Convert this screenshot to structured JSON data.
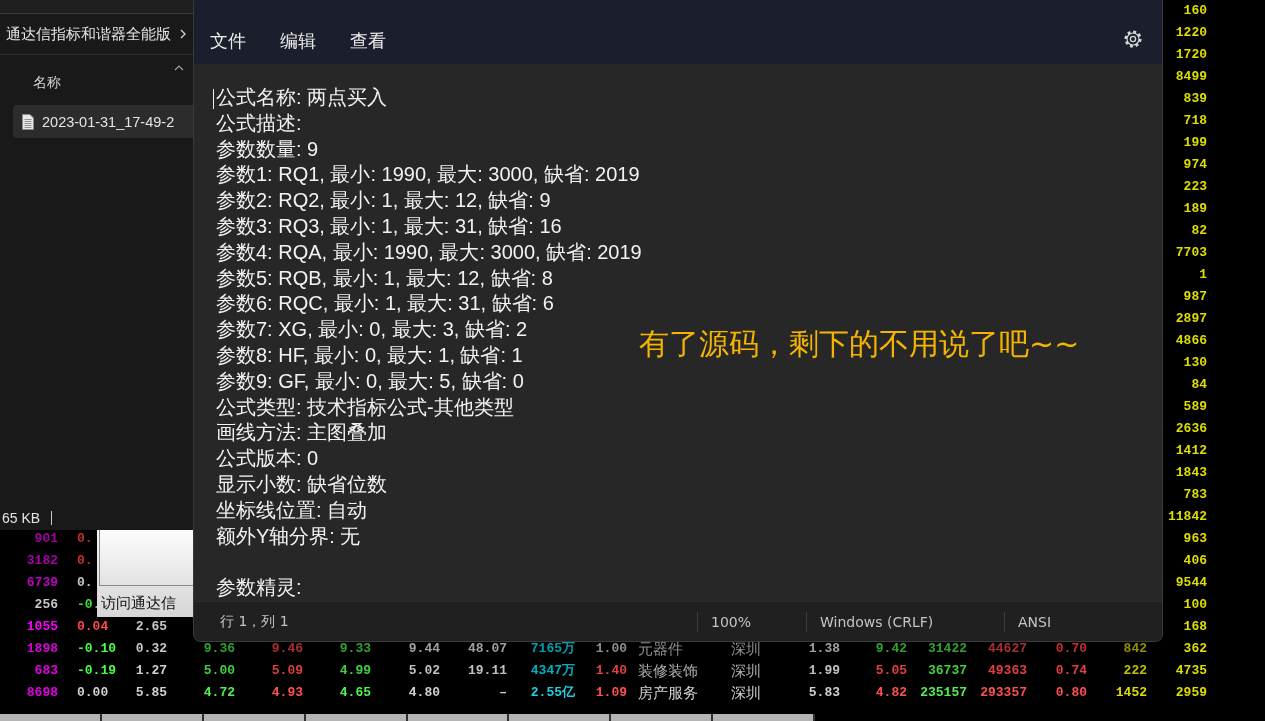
{
  "quote_table": {
    "rows": [
      {
        "last_column": {
          "text": "160",
          "color": "#dede00"
        }
      },
      {
        "last_column": {
          "text": "1220",
          "color": "#dede00"
        }
      },
      {
        "last_column": {
          "text": "1720",
          "color": "#dede00"
        }
      },
      {
        "last_column": {
          "text": "8499",
          "color": "#dede00"
        }
      },
      {
        "last_column": {
          "text": "839",
          "color": "#dede00"
        }
      },
      {
        "last_column": {
          "text": "718",
          "color": "#dede00"
        }
      },
      {
        "last_column": {
          "text": "199",
          "color": "#dede00"
        }
      },
      {
        "last_column": {
          "text": "974",
          "color": "#dede00"
        }
      },
      {
        "last_column": {
          "text": "223",
          "color": "#dede00"
        }
      },
      {
        "last_column": {
          "text": "189",
          "color": "#dede00"
        }
      },
      {
        "last_column": {
          "text": "82",
          "color": "#dede00"
        }
      },
      {
        "last_column": {
          "text": "7703",
          "color": "#dede00"
        }
      },
      {
        "last_column": {
          "text": "1",
          "color": "#dede00"
        }
      },
      {
        "last_column": {
          "text": "987",
          "color": "#dede00"
        }
      },
      {
        "last_column": {
          "text": "2897",
          "color": "#dede00"
        }
      },
      {
        "last_column": {
          "text": "4866",
          "color": "#dede00"
        }
      },
      {
        "last_column": {
          "text": "130",
          "color": "#dede00"
        }
      },
      {
        "last_column": {
          "text": "84",
          "color": "#dede00"
        }
      },
      {
        "last_column": {
          "text": "589",
          "color": "#dede00"
        }
      },
      {
        "last_column": {
          "text": "2636",
          "color": "#dede00"
        }
      },
      {
        "last_column": {
          "text": "1412",
          "color": "#dede00"
        }
      },
      {
        "last_column": {
          "text": "1843",
          "color": "#dede00"
        }
      },
      {
        "last_column": {
          "text": "783",
          "color": "#dede00"
        }
      },
      {
        "last_column": {
          "text": "11842",
          "color": "#dede00"
        }
      },
      {
        "cells": [
          {
            "text": "901",
            "color": "#a000a0"
          },
          {
            "text": "0.",
            "color": "#c03030"
          }
        ],
        "last_column": {
          "text": "963",
          "color": "#dede00"
        }
      },
      {
        "cells": [
          {
            "text": "3182",
            "color": "#a800a8"
          },
          {
            "text": "0.",
            "color": "#c83030"
          }
        ],
        "last_column": {
          "text": "406",
          "color": "#dede00"
        }
      },
      {
        "cells": [
          {
            "text": "6739",
            "color": "#c000c0"
          },
          {
            "text": "0.",
            "color": "#c8c8c8"
          }
        ],
        "last_column": {
          "text": "9544",
          "color": "#dede00"
        }
      },
      {
        "cells": [
          {
            "text": "256",
            "color": "#c8c8c8"
          },
          {
            "text": "-0.",
            "color": "#40e040"
          }
        ],
        "last_column": {
          "text": "100",
          "color": "#dede00"
        }
      },
      {
        "cells": [
          {
            "text": "1055",
            "color": "#ff00ff"
          },
          {
            "text": "0.04",
            "color": "#ff4848"
          },
          {
            "text": "2.65",
            "color": "#c8c8c8"
          }
        ],
        "last_column": {
          "text": "168",
          "color": "#dede00"
        }
      },
      {
        "cells": [
          {
            "text": "1898",
            "color": "#d800d8"
          },
          {
            "text": "-0.10",
            "color": "#48ff48"
          },
          {
            "text": "0.32",
            "color": "#c8c8c8"
          },
          {
            "text": "9.36",
            "color": "#30a030"
          },
          {
            "text": "9.46",
            "color": "#a83030"
          },
          {
            "text": "9.33",
            "color": "#30a030"
          },
          {
            "text": "9.44",
            "color": "#a0a0a0"
          },
          {
            "text": "48.07",
            "color": "#a0a0a0"
          },
          {
            "text": "7165万",
            "color": "#00a0b0"
          },
          {
            "text": "1.00",
            "color": "#909090"
          },
          {
            "text": "元器件",
            "color": "#909090"
          },
          {
            "text": "深圳",
            "color": "#909090"
          },
          {
            "text": "1.38",
            "color": "#a0a0a0"
          },
          {
            "text": "9.42",
            "color": "#30a030"
          },
          {
            "text": "31422",
            "color": "#30a030"
          },
          {
            "text": "44627",
            "color": "#a83030"
          },
          {
            "text": "0.70",
            "color": "#c03030"
          },
          {
            "text": "842",
            "color": "#909000"
          }
        ],
        "last_column": {
          "text": "362",
          "color": "#dede00"
        }
      },
      {
        "cells": [
          {
            "text": "683",
            "color": "#e000e0"
          },
          {
            "text": "-0.19",
            "color": "#48ff48"
          },
          {
            "text": "1.27",
            "color": "#d0d0d0"
          },
          {
            "text": "5.00",
            "color": "#40d040"
          },
          {
            "text": "5.09",
            "color": "#d84040"
          },
          {
            "text": "4.99",
            "color": "#40d040"
          },
          {
            "text": "5.02",
            "color": "#c0c0c0"
          },
          {
            "text": "19.11",
            "color": "#c0c0c0"
          },
          {
            "text": "4347万",
            "color": "#00b0c0"
          },
          {
            "text": "1.40",
            "color": "#e04040"
          },
          {
            "text": "装修装饰",
            "color": "#b0b0b0"
          },
          {
            "text": "深圳",
            "color": "#b0b0b0"
          },
          {
            "text": "1.99",
            "color": "#c0c0c0"
          },
          {
            "text": "5.05",
            "color": "#e04040"
          },
          {
            "text": "36737",
            "color": "#40d040"
          },
          {
            "text": "49363",
            "color": "#e04040"
          },
          {
            "text": "0.74",
            "color": "#e04040"
          },
          {
            "text": "222",
            "color": "#c0c000"
          }
        ],
        "last_column": {
          "text": "4735",
          "color": "#dede00"
        }
      },
      {
        "cells": [
          {
            "text": "8698",
            "color": "#e000e0"
          },
          {
            "text": "0.00",
            "color": "#d0d0d0"
          },
          {
            "text": "5.85",
            "color": "#d0d0d0"
          },
          {
            "text": "4.72",
            "color": "#50f050"
          },
          {
            "text": "4.93",
            "color": "#ff5050"
          },
          {
            "text": "4.65",
            "color": "#50f050"
          },
          {
            "text": "4.80",
            "color": "#d0d0d0"
          },
          {
            "text": "–",
            "color": "#d0d0d0"
          },
          {
            "text": "2.55亿",
            "color": "#20d0e0"
          },
          {
            "text": "1.09",
            "color": "#ff5050"
          },
          {
            "text": "房产服务",
            "color": "#d0d0d0"
          },
          {
            "text": "深圳",
            "color": "#d0d0d0"
          },
          {
            "text": "5.83",
            "color": "#d0d0d0"
          },
          {
            "text": "4.82",
            "color": "#ff5050"
          },
          {
            "text": "235157",
            "color": "#50f050"
          },
          {
            "text": "293357",
            "color": "#ff5050"
          },
          {
            "text": "0.80",
            "color": "#ff5050"
          },
          {
            "text": "1452",
            "color": "#dede00"
          }
        ],
        "last_column": {
          "text": "2959",
          "color": "#dede00"
        }
      }
    ]
  },
  "explorer": {
    "breadcrumb": "通达信指标和谐器全能版",
    "column_header": "名称",
    "files": [
      {
        "name": "2023-01-31_17-49-2",
        "selected": true
      }
    ],
    "status": "65 KB"
  },
  "dialog": {
    "text": "访问通达信"
  },
  "notepad": {
    "menu": [
      "文件",
      "编辑",
      "查看"
    ],
    "paragraphs": [
      {
        "lines": [
          "公式名称: 两点买入",
          "公式描述:",
          "参数数量: 9",
          "参数1: RQ1, 最小: 1990, 最大: 3000, 缺省: 2019",
          "参数2: RQ2, 最小: 1, 最大: 12, 缺省: 9",
          "参数3: RQ3, 最小: 1, 最大: 31, 缺省: 16",
          "参数4: RQA, 最小: 1990, 最大: 3000, 缺省: 2019",
          "参数5: RQB, 最小: 1, 最大: 12, 缺省: 8",
          "参数6: RQC, 最小: 1, 最大: 31, 缺省: 6",
          "参数7: XG, 最小: 0, 最大: 3, 缺省: 2",
          "参数8: HF, 最小: 0, 最大: 1, 缺省: 1",
          "参数9: GF, 最小: 0, 最大: 5, 缺省: 0",
          "公式类型: 技术指标公式-其他类型",
          "画线方法: 主图叠加",
          "公式版本: 0",
          "显示小数: 缺省位数",
          "坐标线位置: 自动",
          "额外Y轴分界: 无"
        ]
      },
      {
        "lines": [
          "参数精灵:"
        ]
      }
    ],
    "status_bar": {
      "position": "行 1，列 1",
      "zoom": "100%",
      "line_ending": "Windows (CRLF)",
      "encoding": "ANSI"
    }
  },
  "annotation": {
    "text": "有了源码，剩下的不用说了吧~~"
  }
}
